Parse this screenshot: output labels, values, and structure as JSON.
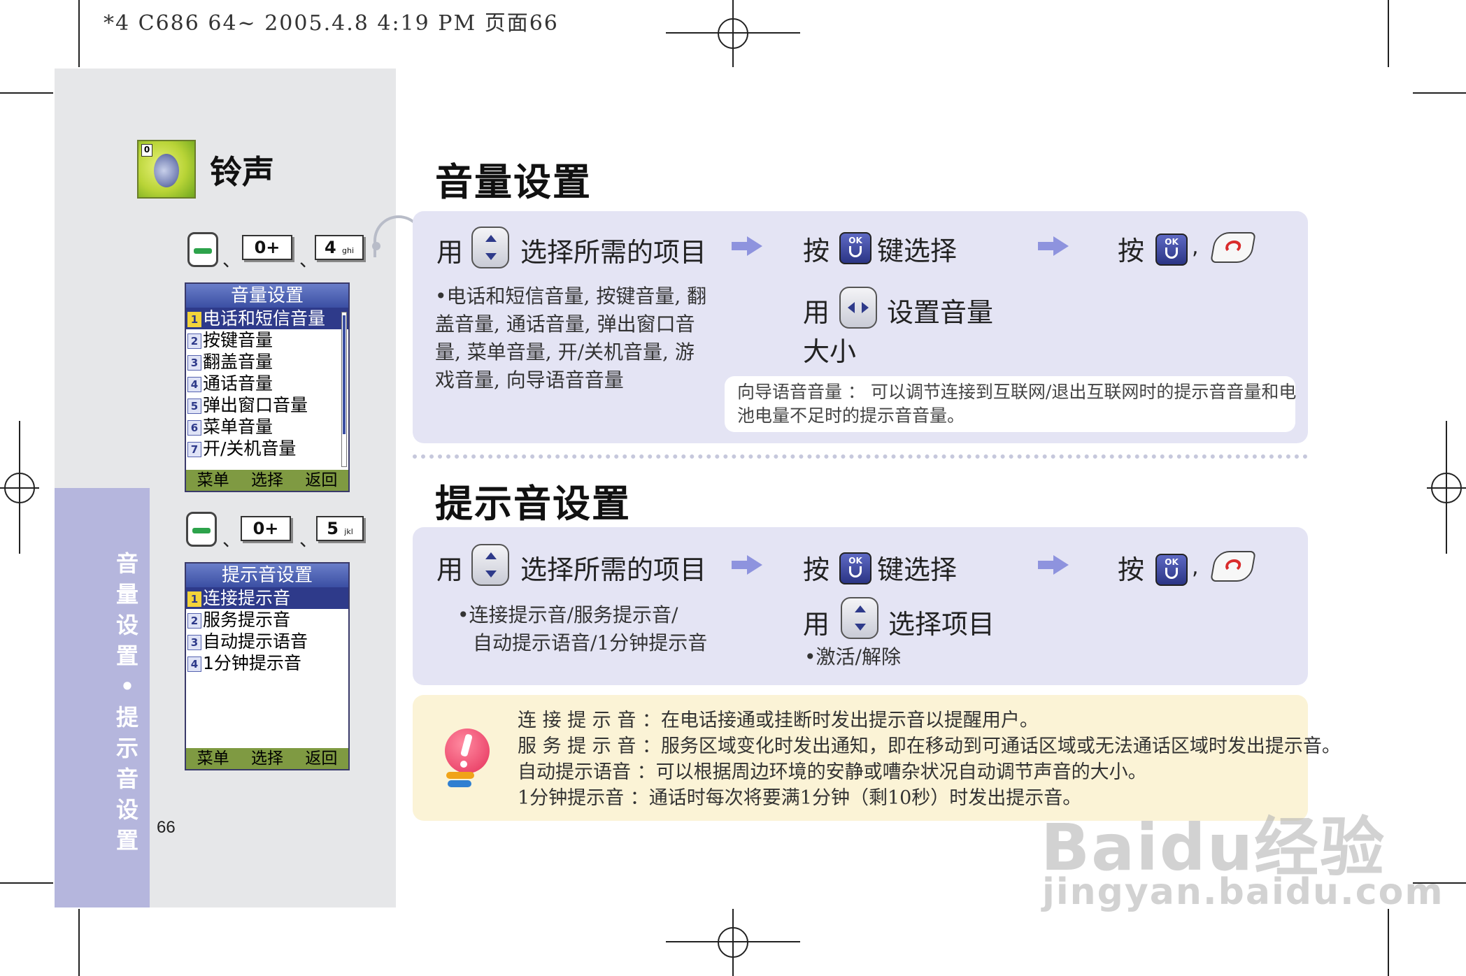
{
  "header": {
    "text": "*4 C686 64~ 2005.4.8 4:19 PM 页面66"
  },
  "sidebar": {
    "app_title": "铃声",
    "tab_label": "音量设置•提示音设置",
    "page_number": "66",
    "key_seq1": {
      "k1": "0+",
      "k2": "4",
      "k2_sub": "ghi"
    },
    "key_seq2": {
      "k1": "0+",
      "k2": "5",
      "k2_sub": "jkl"
    },
    "separator": "、"
  },
  "screen1": {
    "title": "音量设置",
    "items": [
      {
        "num": "1",
        "label": "电话和短信音量"
      },
      {
        "num": "2",
        "label": "按键音量"
      },
      {
        "num": "3",
        "label": "翻盖音量"
      },
      {
        "num": "4",
        "label": "通话音量"
      },
      {
        "num": "5",
        "label": "弹出窗口音量"
      },
      {
        "num": "6",
        "label": "菜单音量"
      },
      {
        "num": "7",
        "label": "开/关机音量"
      }
    ],
    "soft_keys": [
      "菜单",
      "选择",
      "返回"
    ]
  },
  "screen2": {
    "title": "提示音设置",
    "items": [
      {
        "num": "1",
        "label": "连接提示音"
      },
      {
        "num": "2",
        "label": "服务提示音"
      },
      {
        "num": "3",
        "label": "自动提示语音"
      },
      {
        "num": "4",
        "label": "1分钟提示音"
      }
    ],
    "soft_keys": [
      "菜单",
      "选择",
      "返回"
    ]
  },
  "section1": {
    "title": "音量设置",
    "use": "用",
    "select_item": "选择所需的项目",
    "press": "按",
    "key_select": "键选择",
    "comma": ",",
    "set_volume_a": "设置音量",
    "set_volume_b": "大小",
    "bullet_lines": [
      "•电话和短信音量, 按键音量, 翻",
      "盖音量, 通话音量, 弹出窗口音",
      "量, 菜单音量, 开/关机音量, 游",
      "戏音量, 向导语音音量"
    ],
    "note_lines": [
      "向导语音音量 ： 可以调节连接到互联网/退出互联网时的提示音音量和电",
      "池电量不足时的提示音音量。"
    ]
  },
  "section2": {
    "title": "提示音设置",
    "use": "用",
    "select_item": "选择所需的项目",
    "press": "按",
    "key_select": "键选择",
    "comma": ",",
    "select_option": "选择项目",
    "bullet_lines": [
      "•连接提示音/服务提示音/",
      "自动提示语音/1分钟提示音"
    ],
    "sub_bullet": "•激活/解除"
  },
  "tips": {
    "lines": [
      "连 接 提 示 音 ：在电话接通或挂断时发出提示音以提醒用户。",
      "服 务 提 示 音 ：服务区域变化时发出通知，即在移动到可通话区域或无法通话区域时发出提示音。",
      "自动提示语音 ：可以根据周边环境的安静或嘈杂状况自动调节声音的大小。",
      "1分钟提示音 ：通话时每次将要满1分钟（剩10秒）时发出提示音。"
    ]
  },
  "watermark": {
    "brand": "Baidu经验",
    "url": "jingyan.baidu.com"
  }
}
